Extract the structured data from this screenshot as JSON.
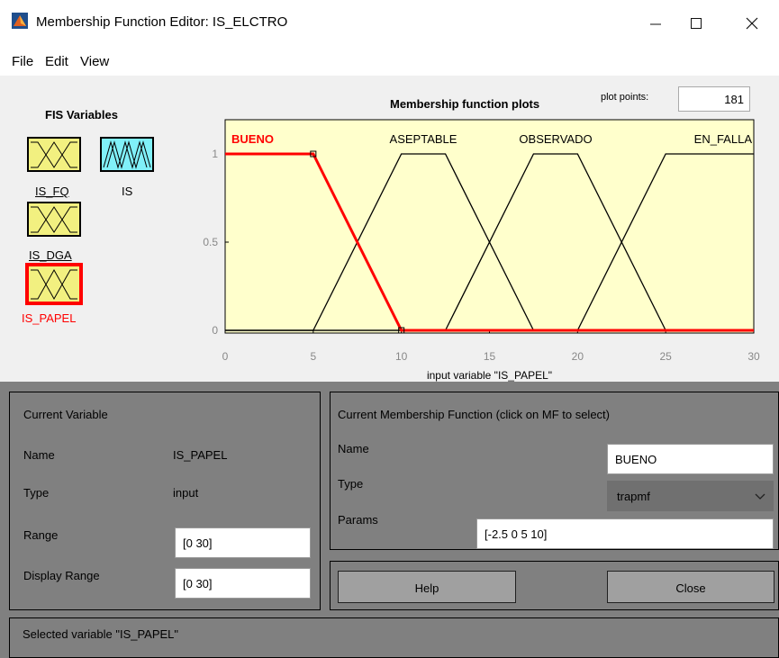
{
  "window": {
    "title": "Membership Function Editor: IS_ELCTRO"
  },
  "menu": [
    "File",
    "Edit",
    "View"
  ],
  "fis_variables": {
    "title": "FIS Variables",
    "items": [
      {
        "label": "IS_FQ",
        "kind": "input",
        "selected": false
      },
      {
        "label": "IS",
        "kind": "output",
        "selected": false
      },
      {
        "label": "IS_DGA",
        "kind": "input",
        "selected": false
      },
      {
        "label": "IS_PAPEL",
        "kind": "input",
        "selected": true
      }
    ]
  },
  "plot": {
    "title": "Membership function plots",
    "plot_points_label": "plot points:",
    "plot_points_value": "181"
  },
  "chart_data": {
    "type": "line",
    "title": "",
    "xlabel": "input variable \"IS_PAPEL\"",
    "ylabel": "",
    "xlim": [
      0,
      30
    ],
    "ylim": [
      0,
      1
    ],
    "xticks": [
      "0",
      "5",
      "10",
      "15",
      "20",
      "25",
      "30"
    ],
    "yticks": [
      "0",
      "0.5",
      "1"
    ],
    "series": [
      {
        "name": "BUENO",
        "x": [
          0,
          5,
          10,
          30
        ],
        "y": [
          1,
          1,
          0,
          0
        ],
        "selected": true,
        "color": "#ff0000"
      },
      {
        "name": "ASEPTABLE",
        "x": [
          0,
          5,
          10,
          12.5,
          17.5,
          30
        ],
        "y": [
          0,
          0,
          1,
          1,
          0,
          0
        ],
        "selected": false,
        "color": "#000000"
      },
      {
        "name": "OBSERVADO",
        "x": [
          0,
          12.5,
          17.5,
          20,
          25,
          30
        ],
        "y": [
          0,
          0,
          1,
          1,
          0,
          0
        ],
        "selected": false,
        "color": "#000000"
      },
      {
        "name": "EN_FALLA",
        "x": [
          0,
          20,
          25,
          30
        ],
        "y": [
          0,
          0,
          1,
          1
        ],
        "selected": false,
        "color": "#000000"
      }
    ]
  },
  "current_variable": {
    "heading": "Current Variable",
    "name_label": "Name",
    "name_value": "IS_PAPEL",
    "type_label": "Type",
    "type_value": "input",
    "range_label": "Range",
    "range_value": "[0 30]",
    "display_range_label": "Display Range",
    "display_range_value": "[0 30]"
  },
  "current_mf": {
    "heading": "Current Membership Function (click on MF to select)",
    "name_label": "Name",
    "name_value": "BUENO",
    "type_label": "Type",
    "type_value": "trapmf",
    "params_label": "Params",
    "params_value": "[-2.5 0 5 10]"
  },
  "buttons": {
    "help": "Help",
    "close": "Close"
  },
  "status": "Selected variable \"IS_PAPEL\"",
  "colors": {
    "plot_bg": "#ffffcc",
    "selected": "#ff0000",
    "panel_bg": "#808080"
  }
}
